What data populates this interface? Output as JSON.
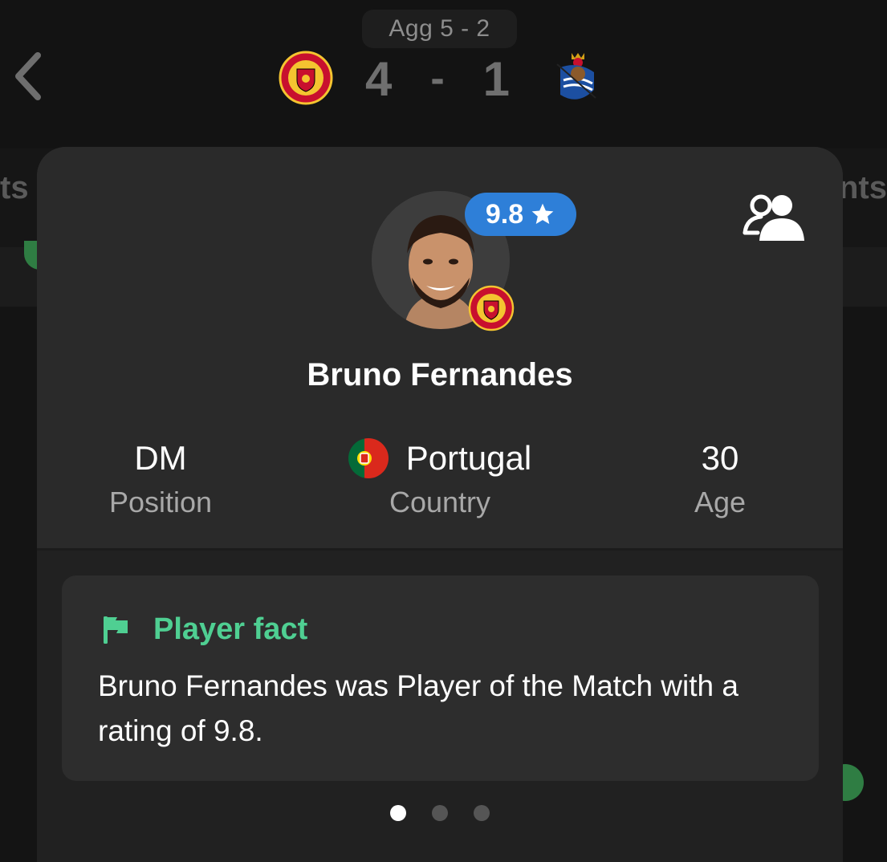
{
  "match": {
    "aggregate": "Agg 5 - 2",
    "home_score": "4",
    "separator": "-",
    "away_score": "1",
    "home_crest_icon": "manchester-united-crest-icon",
    "away_crest_icon": "real-sociedad-crest-icon"
  },
  "background_tabs": {
    "left_fragment": "ts",
    "right_fragment": "nts"
  },
  "player": {
    "rating": "9.8",
    "rating_icon": "star-icon",
    "name": "Bruno Fernandes",
    "position_value": "DM",
    "position_label": "Position",
    "country_value": "Portugal",
    "country_label": "Country",
    "age_value": "30",
    "age_label": "Age"
  },
  "fact": {
    "icon": "flag-icon",
    "title": "Player fact",
    "text": "Bruno Fernandes was Player of the Match with a rating of 9.8."
  },
  "pager": {
    "active_index": 0,
    "count": 3
  },
  "colors": {
    "rating_badge": "#2e7fd8",
    "fact_accent": "#4fcf92",
    "card_background": "#2a2a2a"
  }
}
